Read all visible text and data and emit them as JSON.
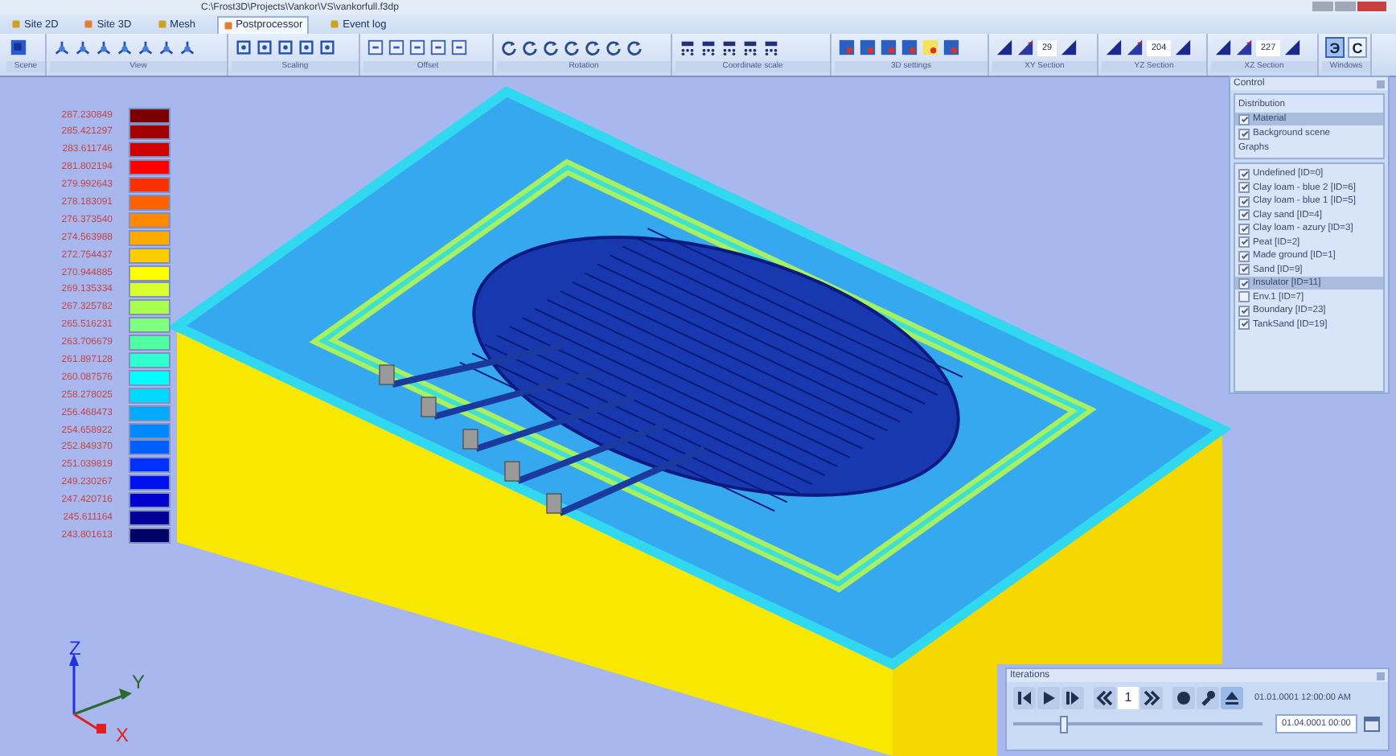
{
  "window": {
    "title": "C:\\Frost3D\\Projects\\Vankor\\VS\\vankorfull.f3dp"
  },
  "menu_tabs": [
    {
      "label": "Site 2D",
      "selected": false
    },
    {
      "label": "Site 3D",
      "selected": false
    },
    {
      "label": "Mesh",
      "selected": false
    },
    {
      "label": "Postprocessor",
      "selected": true
    },
    {
      "label": "Event log",
      "selected": false
    }
  ],
  "ribbon": {
    "groups": [
      {
        "label": "Scene"
      },
      {
        "label": "View"
      },
      {
        "label": "Scaling"
      },
      {
        "label": "Offset"
      },
      {
        "label": "Rotation"
      },
      {
        "label": "Coordinate scale"
      },
      {
        "label": "3D settings"
      },
      {
        "label": "XY Section",
        "value": "29"
      },
      {
        "label": "YZ Section",
        "value": "204"
      },
      {
        "label": "XZ Section",
        "value": "227"
      },
      {
        "label": "Windows",
        "buttons": [
          {
            "text": "Э",
            "selected": true
          },
          {
            "text": "C",
            "selected": false
          }
        ]
      }
    ]
  },
  "legend": [
    {
      "value": "287.230849",
      "color": "#7a0000"
    },
    {
      "value": "285.421297",
      "color": "#a00000"
    },
    {
      "value": "283.611746",
      "color": "#d00000"
    },
    {
      "value": "281.802194",
      "color": "#ff0000"
    },
    {
      "value": "279.992643",
      "color": "#ff3000"
    },
    {
      "value": "278.183091",
      "color": "#ff6000"
    },
    {
      "value": "276.373540",
      "color": "#ff8800"
    },
    {
      "value": "274.563988",
      "color": "#ffaa00"
    },
    {
      "value": "272.754437",
      "color": "#ffcc00"
    },
    {
      "value": "270.944885",
      "color": "#ffff00"
    },
    {
      "value": "269.135334",
      "color": "#d8ff30"
    },
    {
      "value": "267.325782",
      "color": "#a8ff50"
    },
    {
      "value": "265.516231",
      "color": "#80ff80"
    },
    {
      "value": "263.706679",
      "color": "#50ffa0"
    },
    {
      "value": "261.897128",
      "color": "#30ffd0"
    },
    {
      "value": "260.087576",
      "color": "#00ffff"
    },
    {
      "value": "258.278025",
      "color": "#00d8ff"
    },
    {
      "value": "256.468473",
      "color": "#00aaff"
    },
    {
      "value": "254.658922",
      "color": "#0088ff"
    },
    {
      "value": "252.849370",
      "color": "#0060ff"
    },
    {
      "value": "251.039819",
      "color": "#0030ff"
    },
    {
      "value": "249.230267",
      "color": "#0010ee"
    },
    {
      "value": "247.420716",
      "color": "#0000cc"
    },
    {
      "value": "245.611164",
      "color": "#000099"
    },
    {
      "value": "243.801613",
      "color": "#000066"
    }
  ],
  "control": {
    "title": "Control",
    "distribution_label": "Distribution",
    "distribution": [
      {
        "label": "Material",
        "checked": true,
        "selected": true
      },
      {
        "label": "Background scene",
        "checked": true,
        "selected": false
      }
    ],
    "graphs_label": "Graphs",
    "materials": [
      {
        "label": "Undefined [ID=0]",
        "checked": true,
        "selected": false
      },
      {
        "label": "Clay loam - blue 2 [ID=6]",
        "checked": true,
        "selected": false
      },
      {
        "label": "Clay loam - blue 1 [ID=5]",
        "checked": true,
        "selected": false
      },
      {
        "label": "Clay sand [ID=4]",
        "checked": true,
        "selected": false
      },
      {
        "label": "Clay loam - azury [ID=3]",
        "checked": true,
        "selected": false
      },
      {
        "label": "Peat [ID=2]",
        "checked": true,
        "selected": false
      },
      {
        "label": "Made ground [ID=1]",
        "checked": true,
        "selected": false
      },
      {
        "label": "Sand [ID=9]",
        "checked": true,
        "selected": false
      },
      {
        "label": "Insulator [ID=11]",
        "checked": true,
        "selected": true
      },
      {
        "label": "Env.1 [ID=7]",
        "checked": false,
        "selected": false
      },
      {
        "label": "Boundary [ID=23]",
        "checked": true,
        "selected": false
      },
      {
        "label": "TankSand [ID=19]",
        "checked": true,
        "selected": false
      }
    ]
  },
  "iterations": {
    "title": "Iterations",
    "step": "1",
    "current_time": "01.01.0001 12:00:00 AM",
    "date_field": "01.04.0001 00:00",
    "level": 0.2
  },
  "axes": {
    "z": "Z",
    "y": "Y",
    "x": "X"
  }
}
